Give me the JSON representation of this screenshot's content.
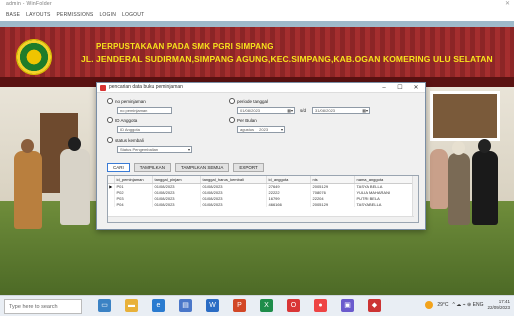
{
  "host_window": {
    "title": "admin - WinFolder",
    "menu": [
      "BASE",
      "LAYOUTS",
      "PERMISSIONS",
      "LOGIN",
      "LOGOUT"
    ]
  },
  "banner": {
    "title": "PERPUSTAKAAN PADA SMK PGRI SIMPANG",
    "subtitle": "JL. JENDERAL SUDIRMAN,SIMPANG AGUNG,KEC.SIMPANG,KAB.OGAN KOMERING ULU SELATAN"
  },
  "dialog": {
    "title": "pencarian data buku peminjaman",
    "minimize": "–",
    "maximize": "☐",
    "close": "✕",
    "filters": {
      "no_peminjaman_label": "no peminjaman",
      "no_peminjaman_placeholder": "no peminjaman",
      "id_anggota_label": "ID Anggota",
      "id_anggota_placeholder": "ID Anggota",
      "status_kembali_label": "status kembali",
      "status_kembali_value": "Status Pengembalian",
      "periode_label": "periode tanggal",
      "date_from": "01/08/2023",
      "date_sep": "s/d",
      "date_to": "31/08/2023",
      "per_bulan_label": "Per Bulan",
      "month_value": "agustus",
      "year_value": "2023"
    },
    "tabs": [
      "CARI",
      "TAMPILKAN",
      "TAMPILKAN SEMUA",
      "EXPORT"
    ],
    "grid": {
      "columns": [
        "id_peminjaman",
        "tanggal_pinjam",
        "tanggal_harus_kembali",
        "id_anggota",
        "nis",
        "nama_anggota"
      ],
      "rows": [
        [
          "P01",
          "01/08/2023",
          "01/08/2023",
          "27649",
          "2005129",
          "TASYA BELLA"
        ],
        [
          "P02",
          "01/08/2023",
          "01/08/2023",
          "22222",
          "708076",
          "YULIA MAHARANI"
        ],
        [
          "P03",
          "01/08/2023",
          "01/08/2023",
          "16799",
          "22204",
          "PUTRI BELA"
        ],
        [
          "P04",
          "01/08/2023",
          "01/08/2023",
          "466166",
          "2005129",
          "TASYABELLA"
        ]
      ],
      "current_row_indicator": "▶"
    }
  },
  "taskbar": {
    "search_placeholder": "Type here to search",
    "weather": "29°C",
    "tray": "^ ☁ ⌁ ⊕ ENG",
    "time": "17:41",
    "date": "22/09/2023"
  },
  "colors": {
    "banner_text": "#f6e31c",
    "roof": "#a42626",
    "dialog_bg": "#f0f0f0",
    "active_tab_border": "#3a7bd5"
  }
}
